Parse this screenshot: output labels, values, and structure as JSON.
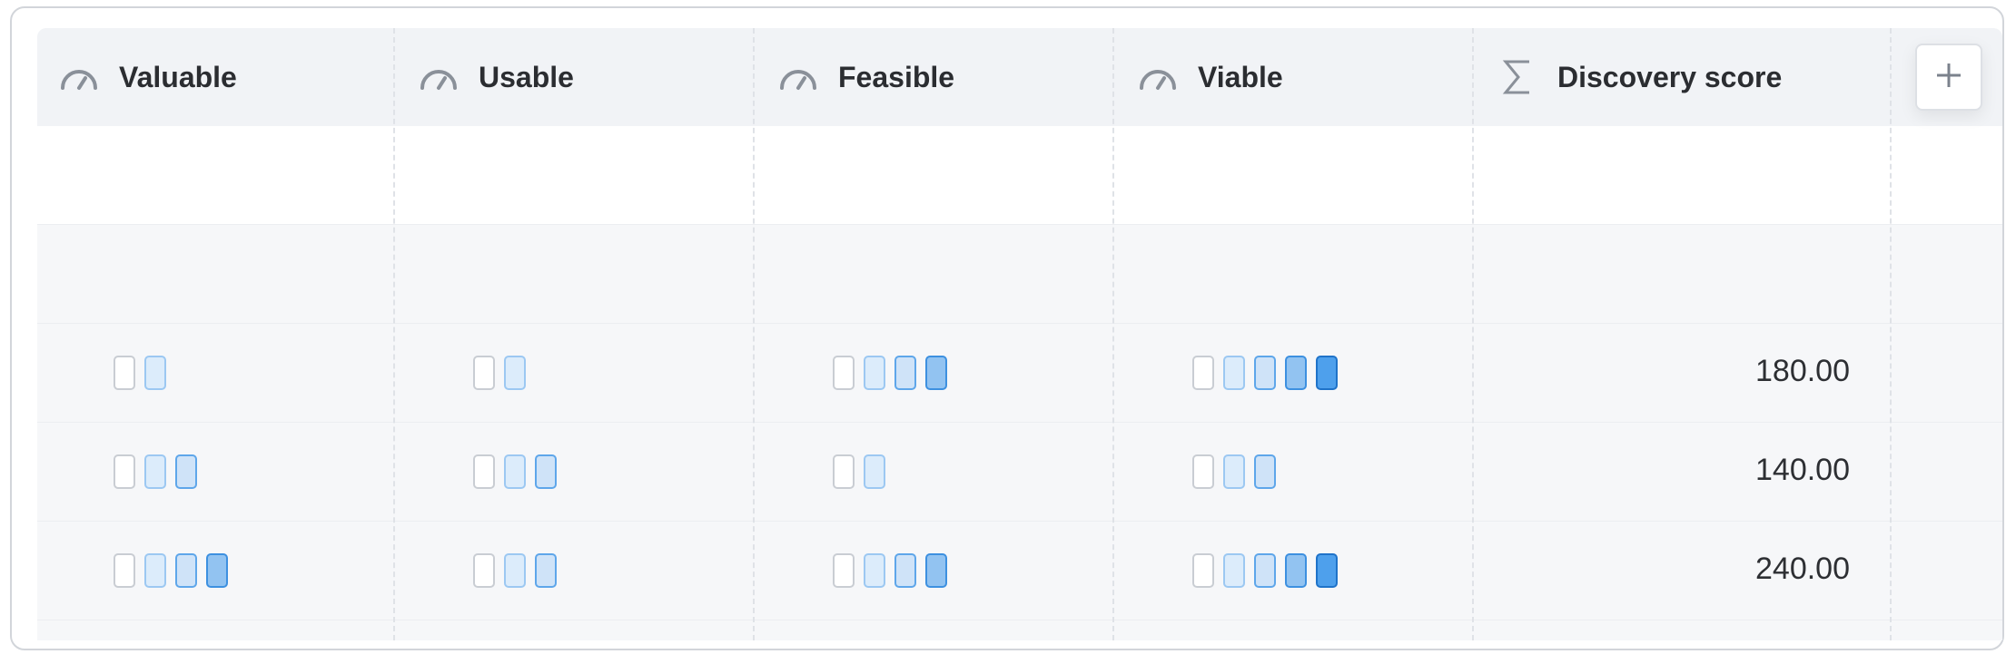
{
  "columns": [
    {
      "label": "Valuable",
      "icon": "gauge-icon"
    },
    {
      "label": "Usable",
      "icon": "gauge-icon"
    },
    {
      "label": "Feasible",
      "icon": "gauge-icon"
    },
    {
      "label": "Viable",
      "icon": "gauge-icon"
    },
    {
      "label": "Discovery score",
      "icon": "sigma-icon"
    }
  ],
  "add_column_icon": "plus-icon",
  "rows": [
    {
      "valuable": null,
      "usable": null,
      "feasible": null,
      "viable": null,
      "score": ""
    },
    {
      "valuable": null,
      "usable": null,
      "feasible": null,
      "viable": null,
      "score": ""
    },
    {
      "valuable": 1,
      "usable": 1,
      "feasible": 3,
      "viable": 4,
      "score": "180.00"
    },
    {
      "valuable": 2,
      "usable": 2,
      "feasible": 1,
      "viable": 2,
      "score": "140.00"
    },
    {
      "valuable": 3,
      "usable": 2,
      "feasible": 3,
      "viable": 4,
      "score": "240.00"
    }
  ],
  "colors": {
    "header_bg": "#f1f3f6",
    "rating_level_1": "#dcecfb",
    "rating_level_2": "#cfe3f8",
    "rating_level_3": "#92c3f1",
    "rating_level_4": "#4ea0ec"
  }
}
